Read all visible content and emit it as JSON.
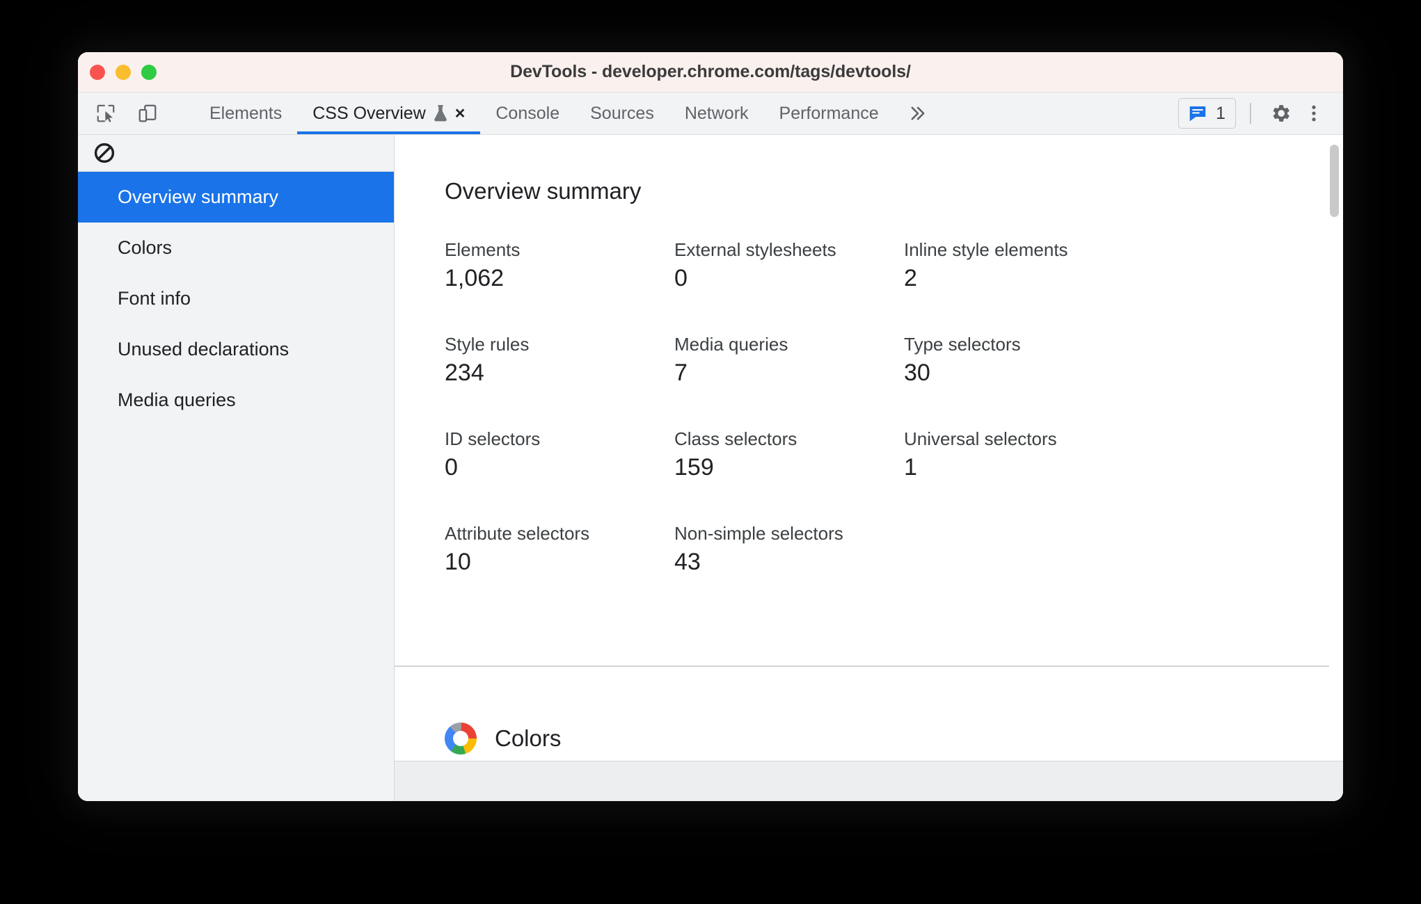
{
  "window": {
    "title": "DevTools - developer.chrome.com/tags/devtools/",
    "traffic_lights": [
      "close-red",
      "minimize-yellow",
      "zoom-green"
    ],
    "colors": {
      "titlebar_bg": "#faf1ef",
      "accent": "#1a73e8",
      "toolbar_bg": "#f1f3f4"
    }
  },
  "toolbar": {
    "inspect_icon": "inspect-element-icon",
    "device_icon": "device-toolbar-icon",
    "overflow_label": "»",
    "issues": {
      "icon": "issues-message-icon",
      "count": "1"
    },
    "settings_icon": "gear-icon",
    "more_icon": "more-vertical-icon"
  },
  "tabs": [
    {
      "label": "Elements",
      "selected": false,
      "closable": false,
      "experiment": false
    },
    {
      "label": "CSS Overview",
      "selected": true,
      "closable": true,
      "experiment": true,
      "flask_icon": "experiment-flask-icon",
      "close_label": "×"
    },
    {
      "label": "Console",
      "selected": false,
      "closable": false,
      "experiment": false
    },
    {
      "label": "Sources",
      "selected": false,
      "closable": false,
      "experiment": false
    },
    {
      "label": "Network",
      "selected": false,
      "closable": false,
      "experiment": false
    },
    {
      "label": "Performance",
      "selected": false,
      "closable": false,
      "experiment": false
    }
  ],
  "sidebar": {
    "clear_icon": "clear-overview-icon",
    "items": [
      {
        "label": "Overview summary",
        "active": true
      },
      {
        "label": "Colors",
        "active": false
      },
      {
        "label": "Font info",
        "active": false
      },
      {
        "label": "Unused declarations",
        "active": false
      },
      {
        "label": "Media queries",
        "active": false
      }
    ]
  },
  "main": {
    "title": "Overview summary",
    "metrics": [
      {
        "label": "Elements",
        "value": "1,062"
      },
      {
        "label": "External stylesheets",
        "value": "0"
      },
      {
        "label": "Inline style elements",
        "value": "2"
      },
      {
        "label": "Style rules",
        "value": "234"
      },
      {
        "label": "Media queries",
        "value": "7"
      },
      {
        "label": "Type selectors",
        "value": "30"
      },
      {
        "label": "ID selectors",
        "value": "0"
      },
      {
        "label": "Class selectors",
        "value": "159"
      },
      {
        "label": "Universal selectors",
        "value": "1"
      },
      {
        "label": "Attribute selectors",
        "value": "10"
      },
      {
        "label": "Non-simple selectors",
        "value": "43"
      },
      {
        "label": "",
        "value": ""
      }
    ],
    "colors_section": {
      "label": "Colors",
      "icon": "color-wheel-icon"
    }
  }
}
